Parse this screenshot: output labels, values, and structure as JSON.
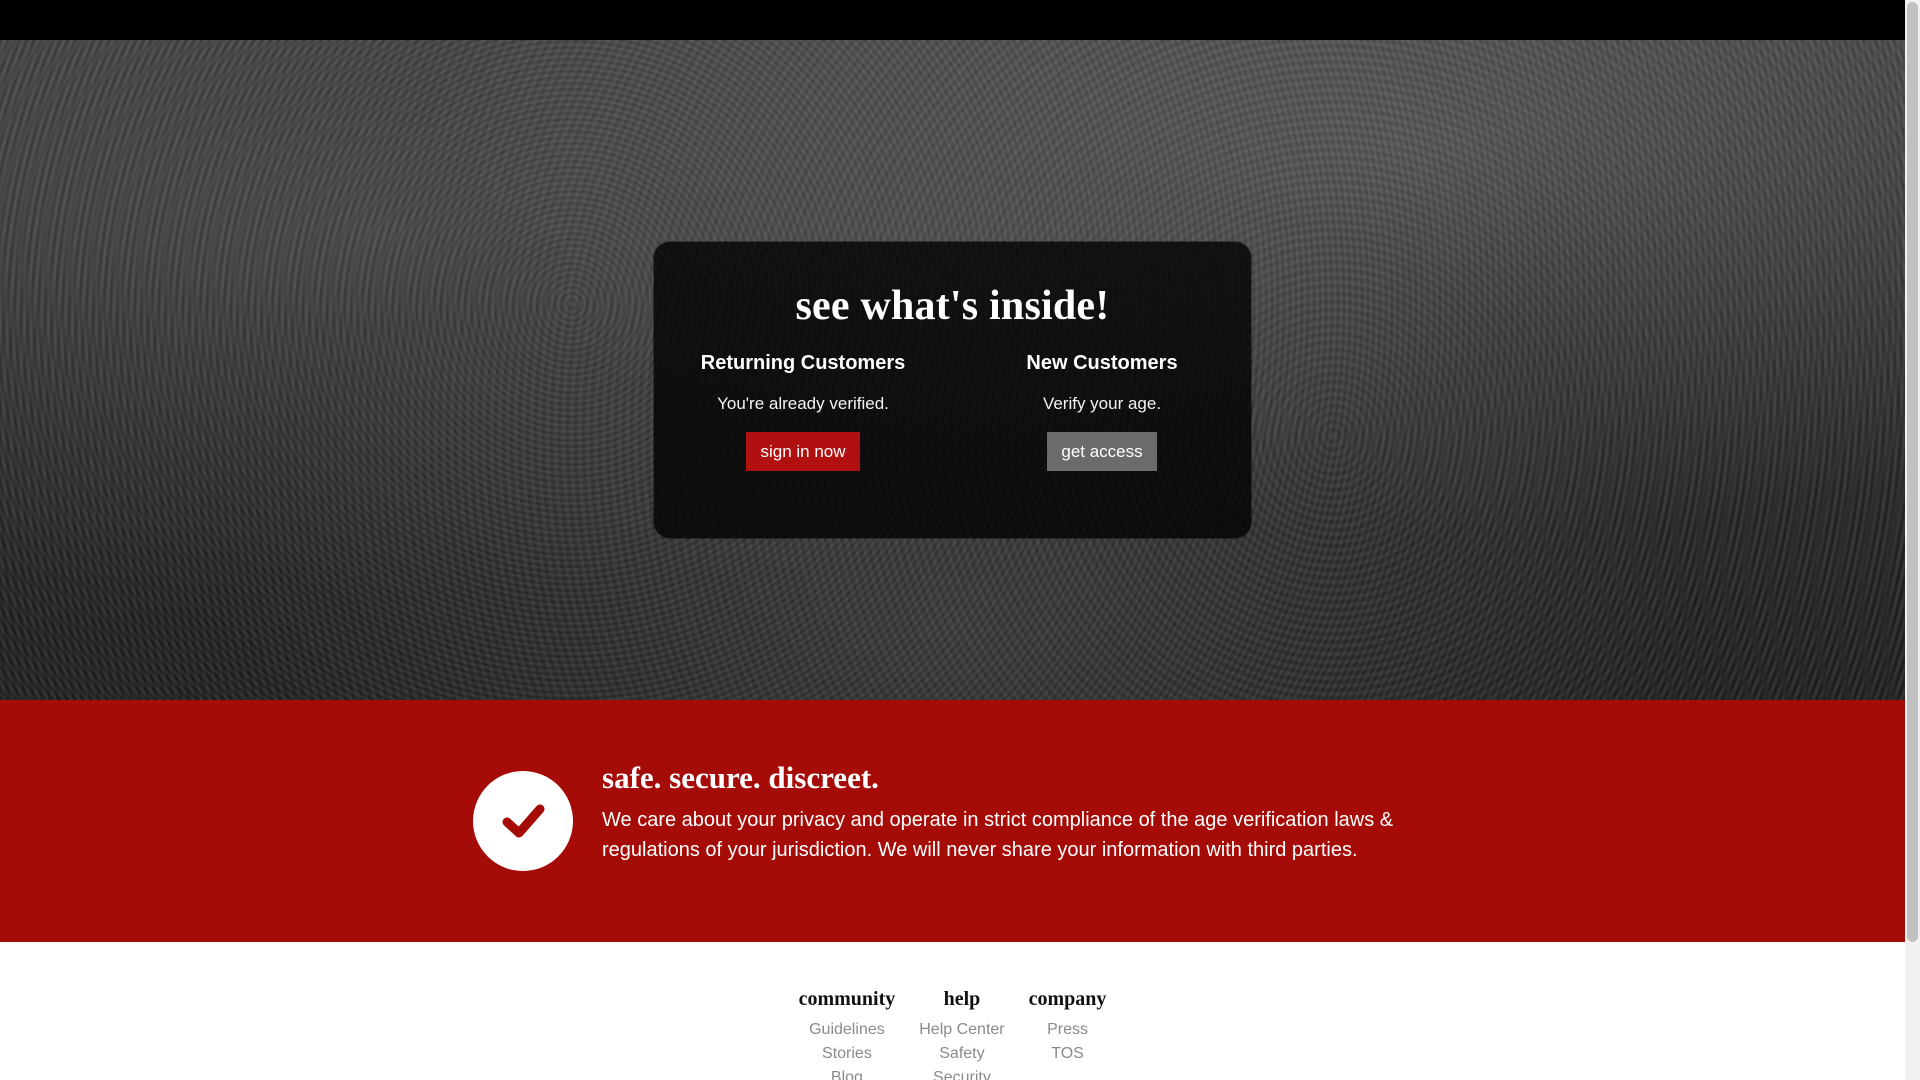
{
  "hero": {
    "title": "see what's inside!",
    "returning": {
      "heading": "Returning Customers",
      "text": "You're already verified.",
      "button_label": "sign in now"
    },
    "new": {
      "heading": "New Customers",
      "text": "Verify your age.",
      "button_label": "get access"
    }
  },
  "trust": {
    "title": "safe. secure. discreet.",
    "body": "We care about your privacy and operate in strict compliance of the age verification laws & regulations of your jurisdiction. We will never share your information with third parties.",
    "icon": "checkmark-icon"
  },
  "footer": {
    "columns": [
      {
        "title": "community",
        "links": [
          "Guidelines",
          "Stories",
          "Blog"
        ]
      },
      {
        "title": "help",
        "links": [
          "Help Center",
          "Safety",
          "Security"
        ]
      },
      {
        "title": "company",
        "links": [
          "Press",
          "TOS"
        ]
      }
    ]
  },
  "colors": {
    "trust_bg": "#a50b07",
    "primary_button": "#b01010",
    "secondary_button": "#6b6b6b",
    "footer_link": "#8a8a8a"
  }
}
